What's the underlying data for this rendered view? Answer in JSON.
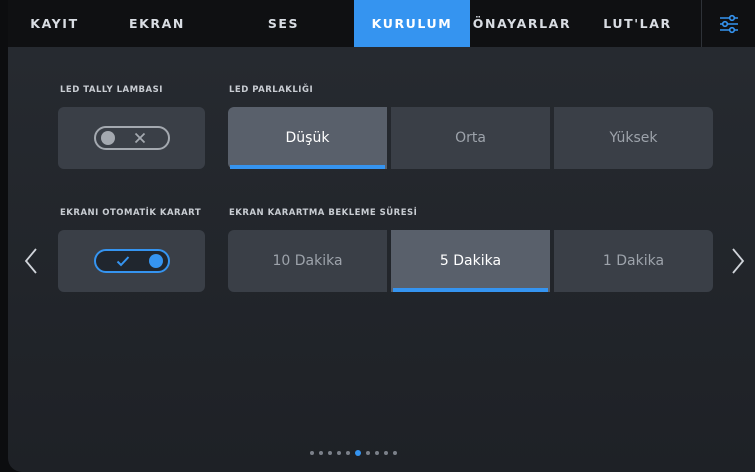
{
  "tabs": [
    {
      "label": "KAYIT",
      "active": false
    },
    {
      "label": "EKRAN",
      "active": false
    },
    {
      "label": "SES",
      "active": false
    },
    {
      "label": "KURULUM",
      "active": true
    },
    {
      "label": "ÖNAYARLAR",
      "active": false
    },
    {
      "label": "LUT'LAR",
      "active": false
    }
  ],
  "menu_icon": "sliders-icon",
  "led_tally": {
    "label": "LED TALLY LAMBASI",
    "enabled": false,
    "icon": "x-icon"
  },
  "led_brightness": {
    "label": "LED PARLAKLIĞI",
    "options": [
      "Düşük",
      "Orta",
      "Yüksek"
    ],
    "selected_index": 0
  },
  "auto_dim": {
    "label": "EKRANI OTOMATİK KARART",
    "enabled": true,
    "icon": "check-icon"
  },
  "dim_delay": {
    "label": "EKRAN KARARTMA BEKLEME SÜRESİ",
    "options": [
      "10 Dakika",
      "5 Dakika",
      "1 Dakika"
    ],
    "selected_index": 1
  },
  "navigation": {
    "prev_icon": "chevron-left-icon",
    "next_icon": "chevron-right-icon"
  },
  "pagination": {
    "total": 10,
    "current": 6
  },
  "colors": {
    "accent": "#3594f0",
    "tab_bar": "#0f1012",
    "panel": "#3a3f47",
    "selected": "#59606b"
  }
}
